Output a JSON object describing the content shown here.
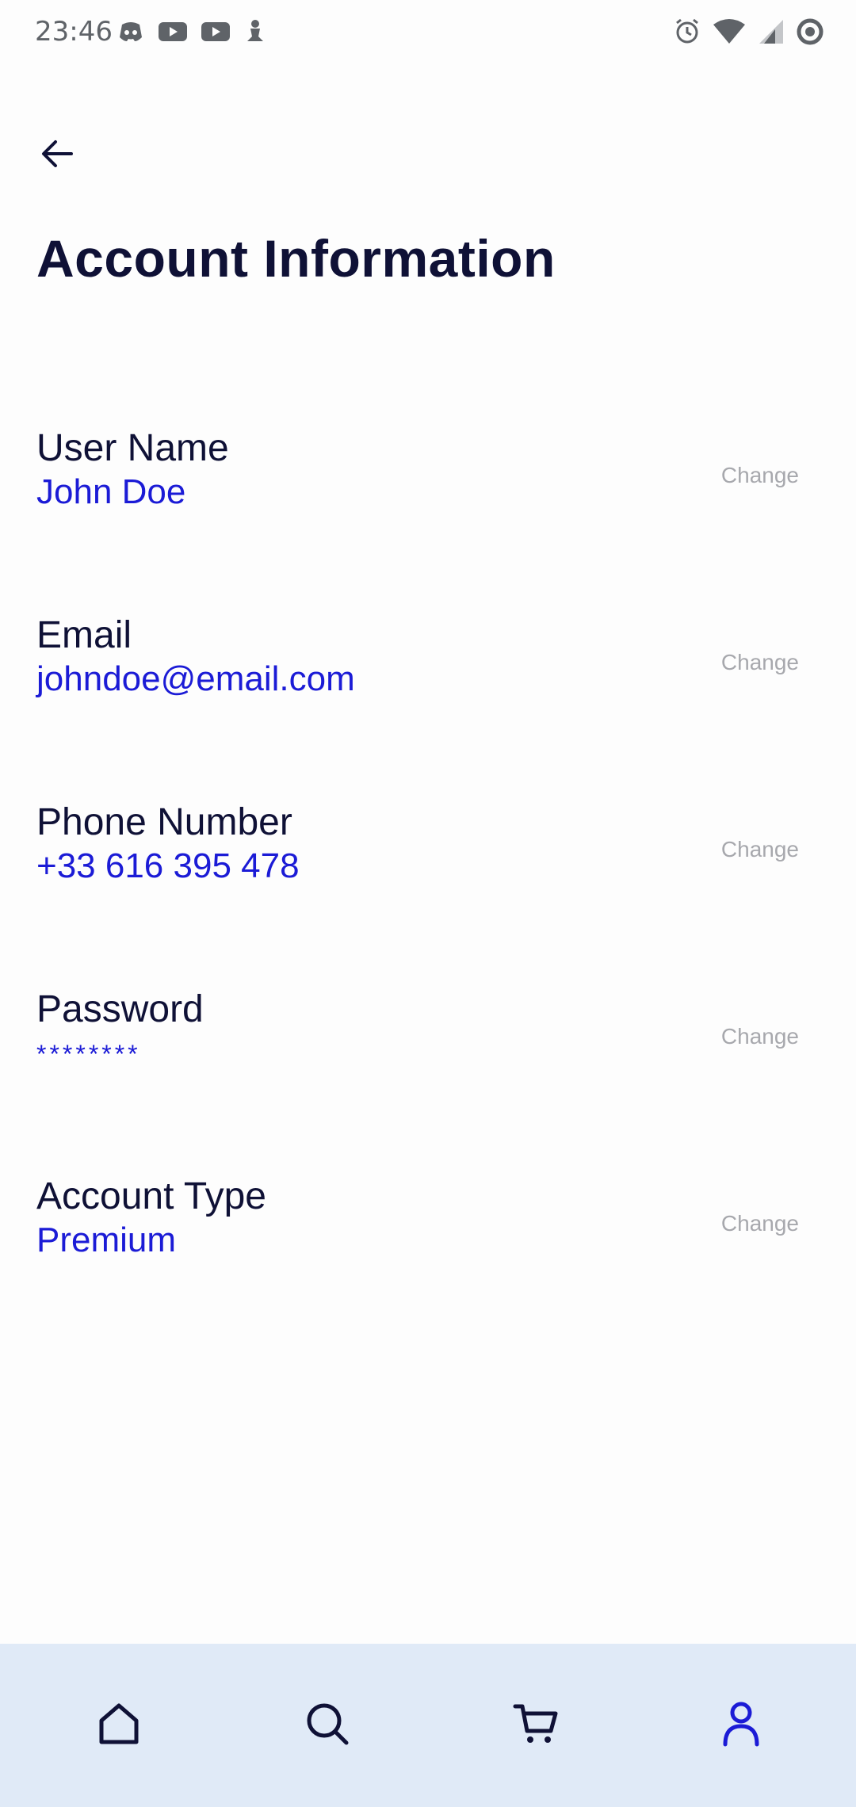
{
  "status_bar": {
    "time": "23:46",
    "left_icons": [
      "discord-icon",
      "youtube-icon",
      "youtube-icon",
      "app-notification-icon"
    ],
    "right_icons": [
      "alarm-icon",
      "wifi-icon",
      "signal-icon",
      "sync-icon"
    ]
  },
  "header": {
    "back_icon": "arrow-left-icon",
    "title": "Account Information"
  },
  "fields": [
    {
      "label": "User Name",
      "value": "John Doe",
      "action": "Change"
    },
    {
      "label": "Email",
      "value": "johndoe@email.com",
      "action": "Change"
    },
    {
      "label": "Phone Number",
      "value": "+33 616 395 478",
      "action": "Change"
    },
    {
      "label": "Password",
      "value": "********",
      "action": "Change"
    },
    {
      "label": "Account Type",
      "value": "Premium",
      "action": "Change"
    }
  ],
  "bottom_nav": {
    "items": [
      {
        "icon": "home-icon",
        "active": false
      },
      {
        "icon": "search-icon",
        "active": false
      },
      {
        "icon": "cart-icon",
        "active": false
      },
      {
        "icon": "profile-icon",
        "active": true
      }
    ]
  },
  "colors": {
    "title": "#0f1136",
    "value": "#1b1bd6",
    "change": "#a7a8ad",
    "nav_bg": "#e0eaf7",
    "nav_active": "#1b1bd6",
    "nav_inactive": "#0f1136"
  }
}
